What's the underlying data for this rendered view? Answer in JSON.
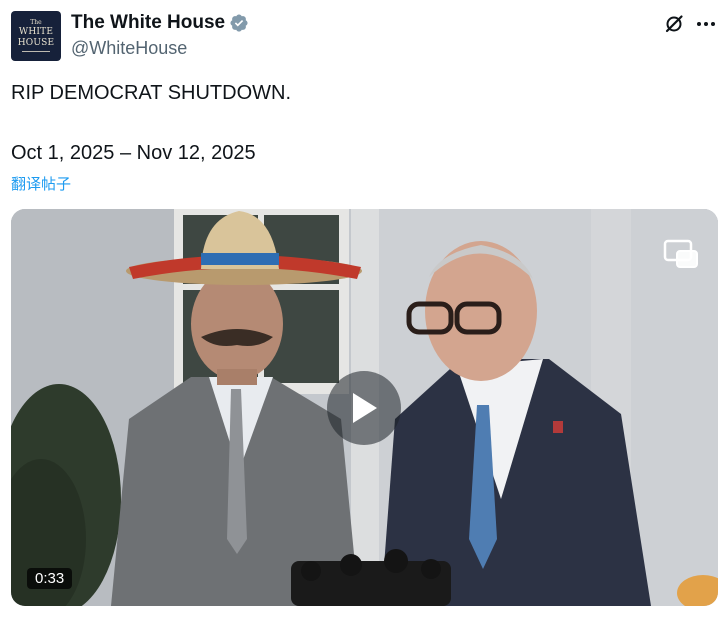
{
  "author": {
    "avatar_lines": [
      "The",
      "WHITE",
      "HOUSE"
    ],
    "display_name": "The White House",
    "handle": "@WhiteHouse",
    "verified": true,
    "verified_color": "#829aab"
  },
  "header_actions": {
    "grok_icon": "grok-icon",
    "more_icon": "more-options-icon"
  },
  "tweet": {
    "text": "RIP DEMOCRAT SHUTDOWN.",
    "dates": "Oct 1, 2025 – Nov 12, 2025",
    "translate_label": "翻译帖子",
    "link_color": "#1d9bf0"
  },
  "video": {
    "duration": "0:33",
    "play_icon": "play-icon",
    "pip_icon": "picture-in-picture-icon"
  }
}
